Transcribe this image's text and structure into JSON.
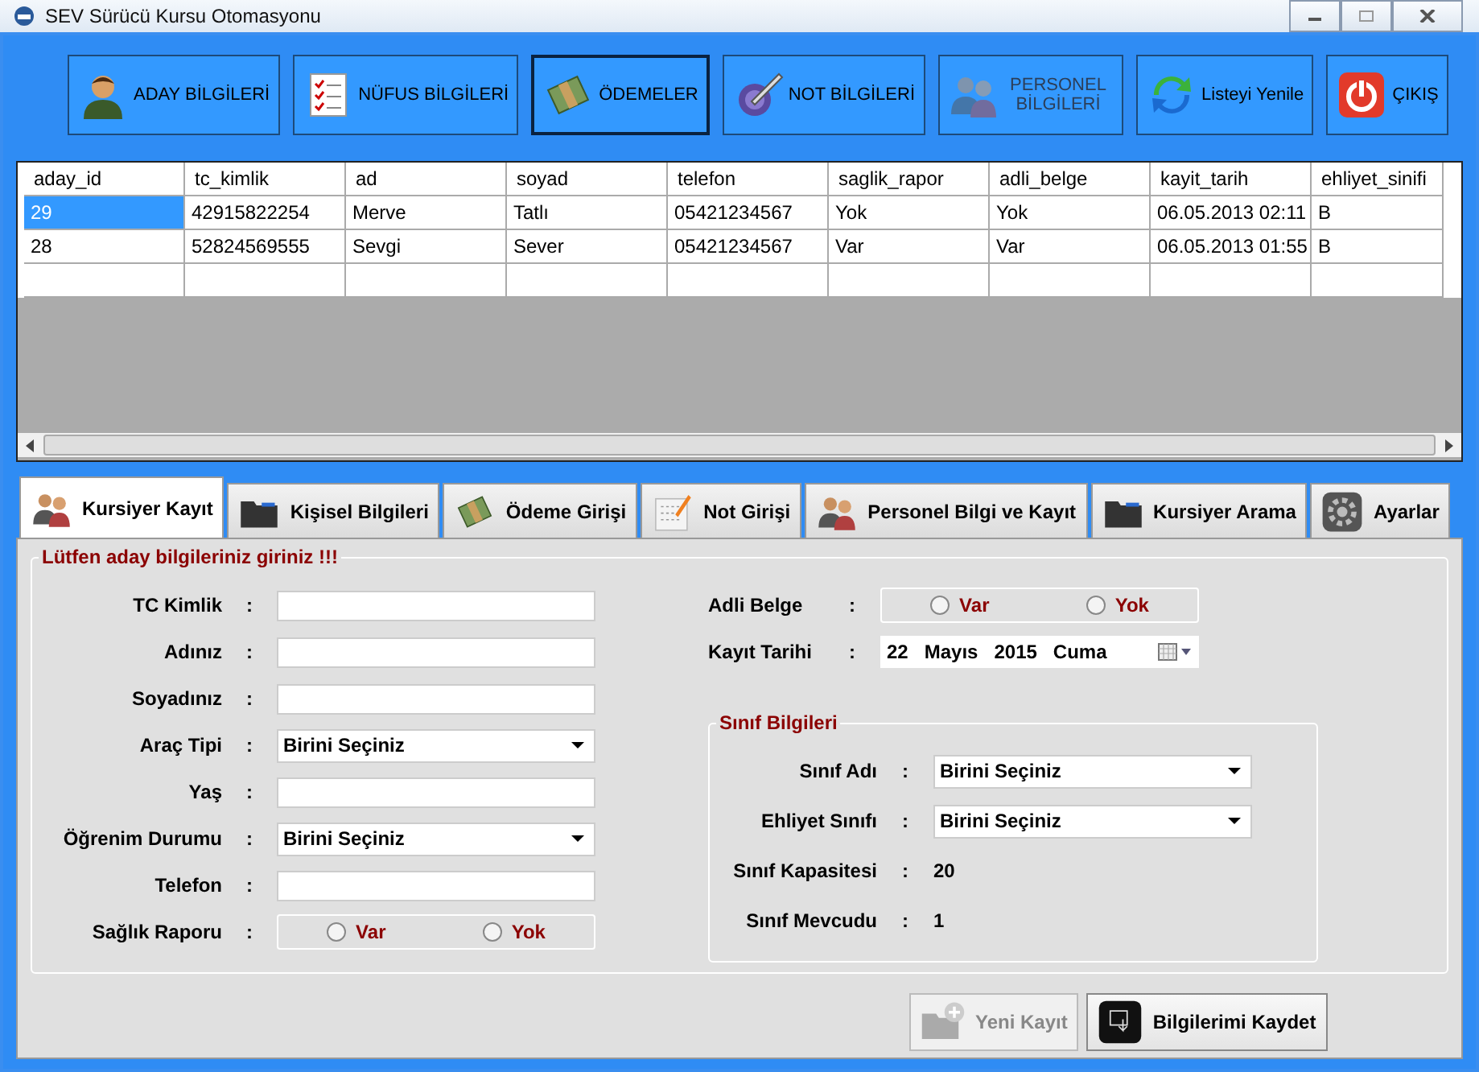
{
  "window": {
    "title": "SEV Sürücü Kursu Otomasyonu"
  },
  "toolbar": [
    {
      "label": "ADAY BİLGİLERİ",
      "disabled": false,
      "focused": false
    },
    {
      "label": "NÜFUS BİLGİLERİ",
      "disabled": false,
      "focused": false
    },
    {
      "label": "ÖDEMELER",
      "disabled": false,
      "focused": true
    },
    {
      "label": "NOT BİLGİLERİ",
      "disabled": false,
      "focused": false
    },
    {
      "label": "PERSONEL BİLGİLERİ",
      "disabled": true,
      "focused": false
    },
    {
      "label": "Listeyi Yenile",
      "disabled": false,
      "focused": false
    },
    {
      "label": "ÇIKIŞ",
      "disabled": false,
      "focused": false
    }
  ],
  "table": {
    "columns": [
      "aday_id",
      "tc_kimlik",
      "ad",
      "soyad",
      "telefon",
      "saglik_rapor",
      "adli_belge",
      "kayit_tarih",
      "ehliyet_sinifi"
    ],
    "rows": [
      {
        "selected": true,
        "cells": [
          "29",
          "42915822254",
          "Merve",
          "Tatlı",
          "05421234567",
          "Yok",
          "Yok",
          "06.05.2013 02:11",
          "B"
        ]
      },
      {
        "selected": false,
        "cells": [
          "28",
          "52824569555",
          "Sevgi",
          "Sever",
          "05421234567",
          "Var",
          "Var",
          "06.05.2013 01:55",
          "B"
        ]
      }
    ]
  },
  "tabs": [
    {
      "label": "Kursiyer Kayıt",
      "selected": true
    },
    {
      "label": "Kişisel Bilgileri",
      "selected": false
    },
    {
      "label": "Ödeme Girişi",
      "selected": false
    },
    {
      "label": "Not Girişi",
      "selected": false
    },
    {
      "label": "Personel Bilgi ve Kayıt",
      "selected": false
    },
    {
      "label": "Kursiyer Arama",
      "selected": false
    },
    {
      "label": "Ayarlar",
      "selected": false
    }
  ],
  "form": {
    "title": "Lütfen aday bilgileriniz giriniz !!!",
    "left": [
      {
        "kind": "text",
        "label": "TC Kimlik"
      },
      {
        "kind": "text",
        "label": "Adınız"
      },
      {
        "kind": "text",
        "label": "Soyadınız"
      },
      {
        "kind": "select",
        "label": "Araç Tipi",
        "value": "Birini Seçiniz"
      },
      {
        "kind": "text",
        "label": "Yaş"
      },
      {
        "kind": "select",
        "label": "Öğrenim Durumu",
        "value": "Birini Seçiniz"
      },
      {
        "kind": "text",
        "label": "Telefon"
      },
      {
        "kind": "radio",
        "label": "Sağlık Raporu",
        "options": [
          {
            "label": "Var",
            "selected": false
          },
          {
            "label": "Yok",
            "selected": false
          }
        ]
      }
    ],
    "right": [
      {
        "kind": "radio",
        "label": "Adli Belge",
        "options": [
          {
            "label": "Var",
            "selected": false
          },
          {
            "label": "Yok",
            "selected": false
          }
        ]
      },
      {
        "kind": "date",
        "label": "Kayıt Tarihi",
        "parts": [
          "22",
          "Mayıs",
          "2015",
          "Cuma"
        ]
      }
    ],
    "group": {
      "title": "Sınıf Bilgileri",
      "rows": [
        {
          "kind": "select",
          "label": "Sınıf Adı",
          "value": "Birini Seçiniz"
        },
        {
          "kind": "select",
          "label": "Ehliyet Sınıfı",
          "value": "Birini Seçiniz"
        },
        {
          "kind": "value",
          "label": "Sınıf Kapasitesi",
          "value": "20"
        },
        {
          "kind": "value",
          "label": "Sınıf Mevcudu",
          "value": "1"
        }
      ]
    },
    "colon": ":"
  },
  "actions": [
    {
      "label": "Yeni Kayıt",
      "disabled": true
    },
    {
      "label": "Bilgilerimi Kaydet",
      "disabled": false
    }
  ]
}
